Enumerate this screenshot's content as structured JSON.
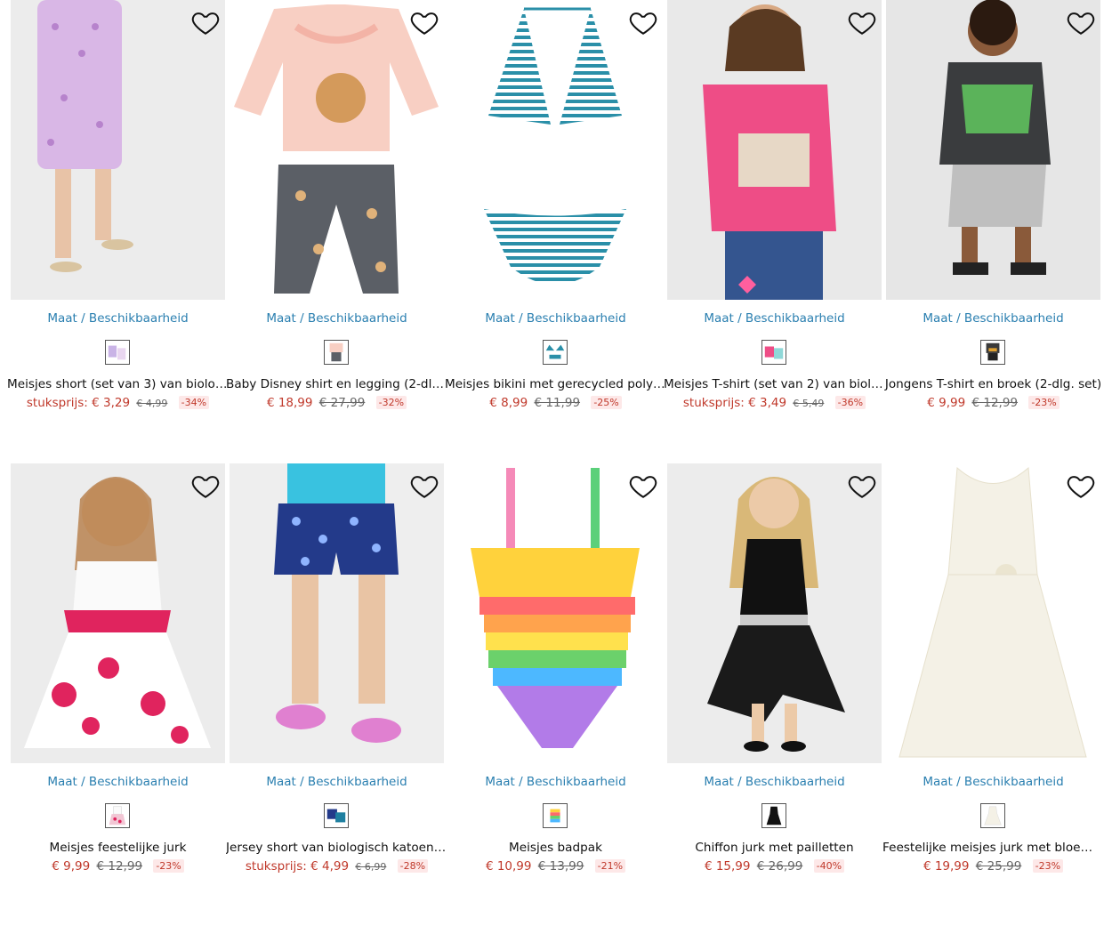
{
  "products": [
    {
      "size_link": "Maat / Beschikbaarheid",
      "title": "Meisjes short (set van 3) van biologi…",
      "price_prefix": "stuksprijs: ",
      "price": "€ 3,29",
      "old_price": "€ 4,99",
      "discount": "-34%",
      "accent": "#d9a7e0"
    },
    {
      "size_link": "Maat / Beschikbaarheid",
      "title": "Baby Disney shirt en legging (2-dlg. …",
      "price_prefix": "",
      "price": "€ 18,99",
      "old_price": "€ 27,99",
      "discount": "-32%",
      "accent": "#f7c9c0"
    },
    {
      "size_link": "Maat / Beschikbaarheid",
      "title": "Meisjes bikini met gerecycled polya…",
      "price_prefix": "",
      "price": "€ 8,99",
      "old_price": "€ 11,99",
      "discount": "-25%",
      "accent": "#2a8fa8"
    },
    {
      "size_link": "Maat / Beschikbaarheid",
      "title": "Meisjes T-shirt (set van 2) van biolo…",
      "price_prefix": "stuksprijs: ",
      "price": "€ 3,49",
      "old_price": "€ 5,49",
      "discount": "-36%",
      "accent": "#e8457d"
    },
    {
      "size_link": "Maat / Beschikbaarheid",
      "title": "Jongens T-shirt en broek (2-dlg. set)",
      "price_prefix": "",
      "price": "€ 9,99",
      "old_price": "€ 12,99",
      "discount": "-23%",
      "accent": "#3a3a3a"
    },
    {
      "size_link": "Maat / Beschikbaarheid",
      "title": "Meisjes feestelijke jurk",
      "price_prefix": "",
      "price": "€ 9,99",
      "old_price": "€ 12,99",
      "discount": "-23%",
      "accent": "#e0245e"
    },
    {
      "size_link": "Maat / Beschikbaarheid",
      "title": "Jersey short van biologisch katoen …",
      "price_prefix": "stuksprijs: ",
      "price": "€ 4,99",
      "old_price": "€ 6,99",
      "discount": "-28%",
      "accent": "#233a8a"
    },
    {
      "size_link": "Maat / Beschikbaarheid",
      "title": "Meisjes badpak",
      "price_prefix": "",
      "price": "€ 10,99",
      "old_price": "€ 13,99",
      "discount": "-21%",
      "accent": "#5bd07a"
    },
    {
      "size_link": "Maat / Beschikbaarheid",
      "title": "Chiffon jurk met pailletten",
      "price_prefix": "",
      "price": "€ 15,99",
      "old_price": "€ 26,99",
      "discount": "-40%",
      "accent": "#111111"
    },
    {
      "size_link": "Maat / Beschikbaarheid",
      "title": "Feestelijke meisjes jurk met bloem…",
      "price_prefix": "",
      "price": "€ 19,99",
      "old_price": "€ 25,99",
      "discount": "-23%",
      "accent": "#f4f1e6"
    }
  ],
  "icons": {
    "wishlist": "heart-outline-icon"
  },
  "colors": {
    "link": "#2a7fb0",
    "price": "#c0392b",
    "discount_bg": "#fde8e8"
  }
}
